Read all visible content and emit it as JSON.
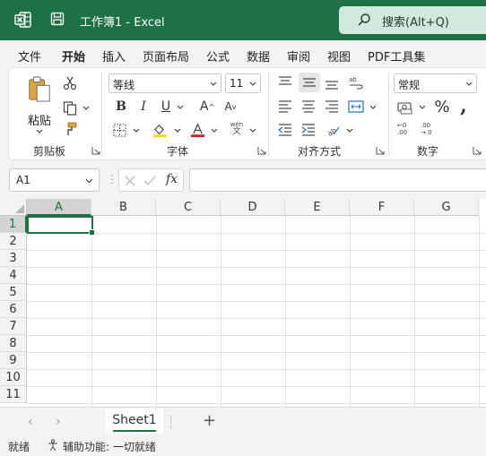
{
  "titlebar": {
    "title": "工作簿1  -  Excel",
    "search_label": "搜索(Alt+Q)"
  },
  "menu": {
    "tabs": [
      "文件",
      "开始",
      "插入",
      "页面布局",
      "公式",
      "数据",
      "审阅",
      "视图",
      "PDF工具集"
    ],
    "active": "开始"
  },
  "ribbon": {
    "clipboard": {
      "label": "剪贴板",
      "paste_label": "粘贴"
    },
    "font": {
      "label": "字体",
      "font_name": "等线",
      "font_size": "11",
      "pinyin_top": "wén",
      "pinyin_bottom": "文"
    },
    "alignment": {
      "label": "对齐方式"
    },
    "number": {
      "label": "数字",
      "format": "常规"
    }
  },
  "formula_bar": {
    "name_box": "A1",
    "fx_label": "fx",
    "formula": ""
  },
  "grid": {
    "columns": [
      "A",
      "B",
      "C",
      "D",
      "E",
      "F",
      "G"
    ],
    "rows": [
      "1",
      "2",
      "3",
      "4",
      "5",
      "6",
      "7",
      "8",
      "9",
      "10",
      "11"
    ],
    "selected_cell": "A1"
  },
  "sheets": {
    "tabs": [
      "Sheet1"
    ],
    "add_label": "+"
  },
  "status": {
    "mode": "就绪",
    "accessibility": "辅助功能: 一切就绪"
  },
  "colors": {
    "brand": "#1e7145",
    "fill_accent": "#ffd700",
    "font_accent": "#d02020"
  }
}
